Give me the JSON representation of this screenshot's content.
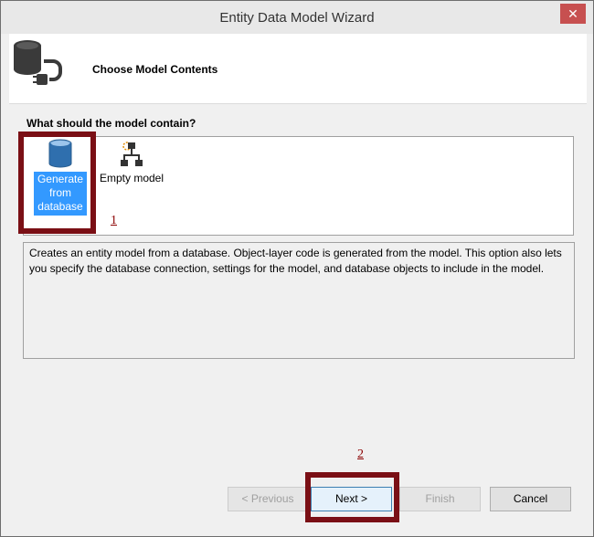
{
  "window": {
    "title": "Entity Data Model Wizard",
    "close_glyph": "✕"
  },
  "header": {
    "title": "Choose Model Contents",
    "icon": "database-connect-icon"
  },
  "question": "What should the model contain?",
  "options": [
    {
      "label": "Generate from database",
      "icon": "database-icon",
      "selected": true
    },
    {
      "label": "Empty model",
      "icon": "empty-model-icon",
      "selected": false
    }
  ],
  "description": "Creates an entity model from a database. Object-layer code is generated from the model. This option also lets you specify the database connection, settings for the model, and database objects to include in the model.",
  "buttons": {
    "previous": "< Previous",
    "next": "Next >",
    "finish": "Finish",
    "cancel": "Cancel"
  },
  "annotations": {
    "one": "1",
    "two": "2",
    "color": "#7a0f15"
  },
  "colors": {
    "selection": "#3399ff",
    "window_bg": "#f0f0f0"
  }
}
